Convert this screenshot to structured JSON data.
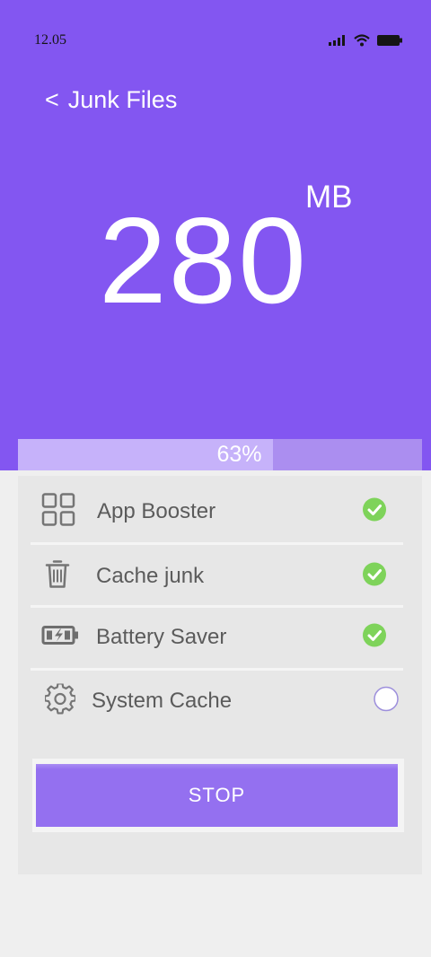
{
  "status_bar": {
    "time": "12.05",
    "icons": [
      "signal-icon",
      "wifi-icon",
      "battery-icon"
    ]
  },
  "header": {
    "back_chevron": "<",
    "title": "Junk Files",
    "size_value": "280",
    "size_unit": "MB"
  },
  "progress": {
    "percent": 63,
    "label": "63%"
  },
  "tasks": [
    {
      "label": "App Booster",
      "icon": "grid-icon",
      "done": true
    },
    {
      "label": "Cache junk",
      "icon": "trash-icon",
      "done": true
    },
    {
      "label": "Battery Saver",
      "icon": "battery-charging-icon",
      "done": true
    },
    {
      "label": "System Cache",
      "icon": "gear-icon",
      "done": false
    }
  ],
  "actions": {
    "stop_label": "STOP"
  },
  "colors": {
    "accent": "#8356f1",
    "check": "#7ed35a",
    "pending_ring": "#9d8fdc"
  }
}
